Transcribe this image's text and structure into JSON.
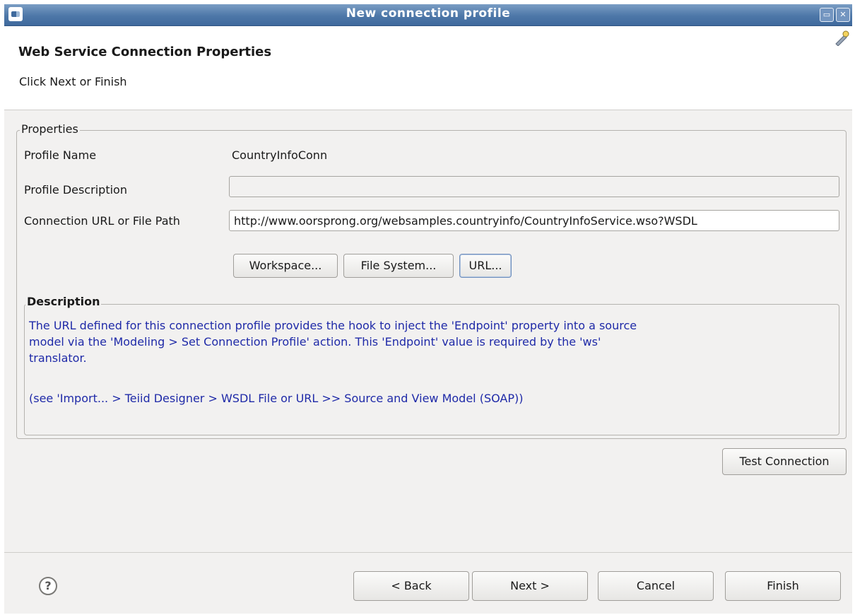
{
  "window": {
    "title": "New connection profile",
    "minimize_glyph": "▭",
    "close_glyph": "✕"
  },
  "header": {
    "heading": "Web Service Connection Properties",
    "subtitle": "Click Next or Finish"
  },
  "properties": {
    "legend": "Properties",
    "profile_name_label": "Profile Name",
    "profile_name_value": "CountryInfoConn",
    "profile_description_label": "Profile Description",
    "profile_description_value": "",
    "connection_url_label": "Connection URL or File Path",
    "connection_url_value": "http://www.oorsprong.org/websamples.countryinfo/CountryInfoService.wso?WSDL",
    "buttons": {
      "workspace": "Workspace...",
      "file_system": "File System...",
      "url": "URL..."
    }
  },
  "description": {
    "legend": "Description",
    "line1": "The URL defined for this connection profile provides the hook to inject the 'Endpoint' property into a source",
    "line2": "model via the 'Modeling > Set Connection Profile' action. This 'Endpoint' value is required by the 'ws'",
    "line3": "translator.",
    "line4": "(see 'Import... > Teiid Designer > WSDL File or URL >> Source and View Model (SOAP))"
  },
  "test_connection_label": "Test Connection",
  "footer": {
    "help_glyph": "?",
    "back_label": "< Back",
    "next_label": "Next >",
    "cancel_label": "Cancel",
    "finish_label": "Finish"
  },
  "colors": {
    "titlebar": "#4d77a8",
    "description_text": "#1f2aa8",
    "dialog_background": "#f2f1f0"
  }
}
